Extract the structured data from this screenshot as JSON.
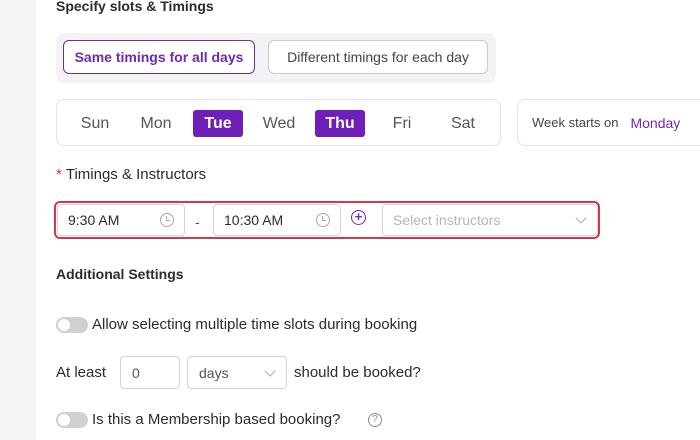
{
  "section": {
    "title": "Specify slots & Timings"
  },
  "timing_mode": {
    "options": [
      "Same timings for all days",
      "Different timings for each day"
    ],
    "selected": "Same timings for all days"
  },
  "days": [
    {
      "label": "Sun",
      "selected": false
    },
    {
      "label": "Mon",
      "selected": false
    },
    {
      "label": "Tue",
      "selected": true
    },
    {
      "label": "Wed",
      "selected": false
    },
    {
      "label": "Thu",
      "selected": true
    },
    {
      "label": "Fri",
      "selected": false
    },
    {
      "label": "Sat",
      "selected": false
    }
  ],
  "week_start": {
    "label": "Week starts on",
    "value": "Monday"
  },
  "timings": {
    "label": "Timings & Instructors",
    "required_mark": "*",
    "start_time": "9:30 AM",
    "separator": "-",
    "end_time": "10:30 AM",
    "instructors_placeholder": "Select instructors"
  },
  "additional": {
    "title": "Additional Settings",
    "multi_slot": {
      "label": "Allow selecting multiple time slots during booking",
      "enabled": false
    },
    "advance": {
      "prefix": "At least",
      "value": "0",
      "unit": "days",
      "suffix": "should be booked?"
    },
    "membership": {
      "label": "Is this a Membership based booking?",
      "enabled": false
    }
  },
  "colors": {
    "accent": "#6b2bb5",
    "highlight": "#d43a45"
  }
}
